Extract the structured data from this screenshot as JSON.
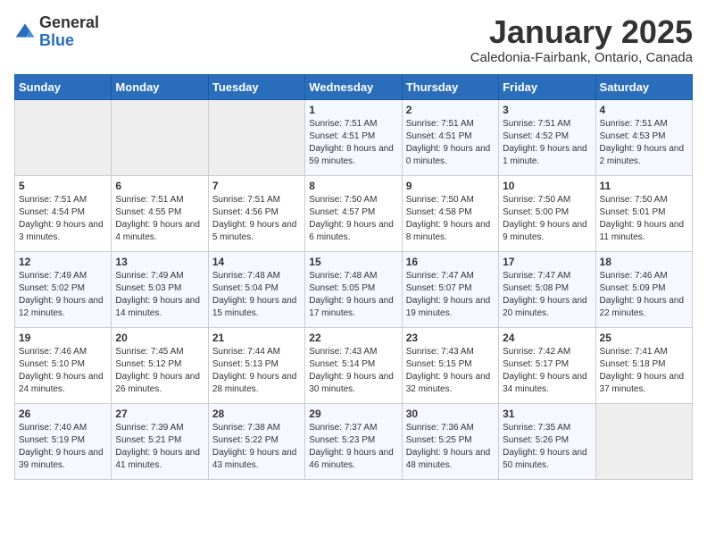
{
  "logo": {
    "general": "General",
    "blue": "Blue"
  },
  "header": {
    "month": "January 2025",
    "location": "Caledonia-Fairbank, Ontario, Canada"
  },
  "days_of_week": [
    "Sunday",
    "Monday",
    "Tuesday",
    "Wednesday",
    "Thursday",
    "Friday",
    "Saturday"
  ],
  "weeks": [
    [
      {
        "day": "",
        "info": ""
      },
      {
        "day": "",
        "info": ""
      },
      {
        "day": "",
        "info": ""
      },
      {
        "day": "1",
        "info": "Sunrise: 7:51 AM\nSunset: 4:51 PM\nDaylight: 8 hours and 59 minutes."
      },
      {
        "day": "2",
        "info": "Sunrise: 7:51 AM\nSunset: 4:51 PM\nDaylight: 9 hours and 0 minutes."
      },
      {
        "day": "3",
        "info": "Sunrise: 7:51 AM\nSunset: 4:52 PM\nDaylight: 9 hours and 1 minute."
      },
      {
        "day": "4",
        "info": "Sunrise: 7:51 AM\nSunset: 4:53 PM\nDaylight: 9 hours and 2 minutes."
      }
    ],
    [
      {
        "day": "5",
        "info": "Sunrise: 7:51 AM\nSunset: 4:54 PM\nDaylight: 9 hours and 3 minutes."
      },
      {
        "day": "6",
        "info": "Sunrise: 7:51 AM\nSunset: 4:55 PM\nDaylight: 9 hours and 4 minutes."
      },
      {
        "day": "7",
        "info": "Sunrise: 7:51 AM\nSunset: 4:56 PM\nDaylight: 9 hours and 5 minutes."
      },
      {
        "day": "8",
        "info": "Sunrise: 7:50 AM\nSunset: 4:57 PM\nDaylight: 9 hours and 6 minutes."
      },
      {
        "day": "9",
        "info": "Sunrise: 7:50 AM\nSunset: 4:58 PM\nDaylight: 9 hours and 8 minutes."
      },
      {
        "day": "10",
        "info": "Sunrise: 7:50 AM\nSunset: 5:00 PM\nDaylight: 9 hours and 9 minutes."
      },
      {
        "day": "11",
        "info": "Sunrise: 7:50 AM\nSunset: 5:01 PM\nDaylight: 9 hours and 11 minutes."
      }
    ],
    [
      {
        "day": "12",
        "info": "Sunrise: 7:49 AM\nSunset: 5:02 PM\nDaylight: 9 hours and 12 minutes."
      },
      {
        "day": "13",
        "info": "Sunrise: 7:49 AM\nSunset: 5:03 PM\nDaylight: 9 hours and 14 minutes."
      },
      {
        "day": "14",
        "info": "Sunrise: 7:48 AM\nSunset: 5:04 PM\nDaylight: 9 hours and 15 minutes."
      },
      {
        "day": "15",
        "info": "Sunrise: 7:48 AM\nSunset: 5:05 PM\nDaylight: 9 hours and 17 minutes."
      },
      {
        "day": "16",
        "info": "Sunrise: 7:47 AM\nSunset: 5:07 PM\nDaylight: 9 hours and 19 minutes."
      },
      {
        "day": "17",
        "info": "Sunrise: 7:47 AM\nSunset: 5:08 PM\nDaylight: 9 hours and 20 minutes."
      },
      {
        "day": "18",
        "info": "Sunrise: 7:46 AM\nSunset: 5:09 PM\nDaylight: 9 hours and 22 minutes."
      }
    ],
    [
      {
        "day": "19",
        "info": "Sunrise: 7:46 AM\nSunset: 5:10 PM\nDaylight: 9 hours and 24 minutes."
      },
      {
        "day": "20",
        "info": "Sunrise: 7:45 AM\nSunset: 5:12 PM\nDaylight: 9 hours and 26 minutes."
      },
      {
        "day": "21",
        "info": "Sunrise: 7:44 AM\nSunset: 5:13 PM\nDaylight: 9 hours and 28 minutes."
      },
      {
        "day": "22",
        "info": "Sunrise: 7:43 AM\nSunset: 5:14 PM\nDaylight: 9 hours and 30 minutes."
      },
      {
        "day": "23",
        "info": "Sunrise: 7:43 AM\nSunset: 5:15 PM\nDaylight: 9 hours and 32 minutes."
      },
      {
        "day": "24",
        "info": "Sunrise: 7:42 AM\nSunset: 5:17 PM\nDaylight: 9 hours and 34 minutes."
      },
      {
        "day": "25",
        "info": "Sunrise: 7:41 AM\nSunset: 5:18 PM\nDaylight: 9 hours and 37 minutes."
      }
    ],
    [
      {
        "day": "26",
        "info": "Sunrise: 7:40 AM\nSunset: 5:19 PM\nDaylight: 9 hours and 39 minutes."
      },
      {
        "day": "27",
        "info": "Sunrise: 7:39 AM\nSunset: 5:21 PM\nDaylight: 9 hours and 41 minutes."
      },
      {
        "day": "28",
        "info": "Sunrise: 7:38 AM\nSunset: 5:22 PM\nDaylight: 9 hours and 43 minutes."
      },
      {
        "day": "29",
        "info": "Sunrise: 7:37 AM\nSunset: 5:23 PM\nDaylight: 9 hours and 46 minutes."
      },
      {
        "day": "30",
        "info": "Sunrise: 7:36 AM\nSunset: 5:25 PM\nDaylight: 9 hours and 48 minutes."
      },
      {
        "day": "31",
        "info": "Sunrise: 7:35 AM\nSunset: 5:26 PM\nDaylight: 9 hours and 50 minutes."
      },
      {
        "day": "",
        "info": ""
      }
    ]
  ]
}
